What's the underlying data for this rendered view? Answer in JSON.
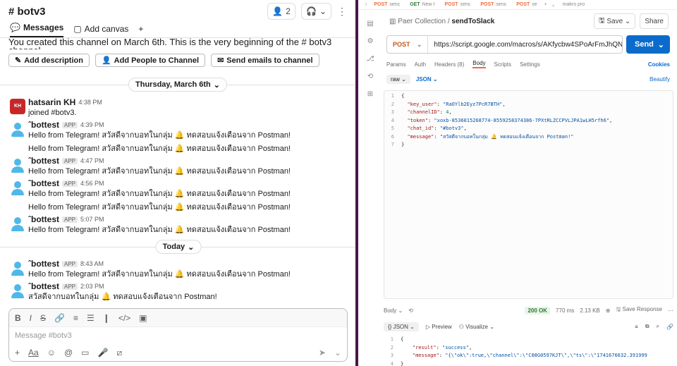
{
  "slack": {
    "channel": "# botv3",
    "members_count": "2",
    "tabs": [
      {
        "label": "Messages"
      },
      {
        "label": "Add canvas"
      }
    ],
    "intro": "You created this channel on March 6th. This is the very beginning of the # botv3 channel.",
    "buttons": {
      "add_description": "Add description",
      "add_people": "Add People to Channel",
      "send_emails": "Send emails to channel"
    },
    "date1": "Thursday, March 6th",
    "date2": "Today",
    "messages": [
      {
        "name": "hatsarin KH",
        "time": "4:38 PM",
        "lines": [
          "joined #botv3."
        ],
        "app": ""
      },
      {
        "name": "ˆbottest",
        "app": "APP",
        "time": "4:39 PM",
        "lines": [
          "Hello from Telegram! สวัสดีจากบอทในกลุ่ม 🔔 ทดสอบแจ้งเตือนจาก Postman!",
          "Hello from Telegram! สวัสดีจากบอทในกลุ่ม 🔔 ทดสอบแจ้งเตือนจาก Postman!"
        ]
      },
      {
        "name": "ˆbottest",
        "app": "APP",
        "time": "4:47 PM",
        "lines": [
          "Hello from Telegram! สวัสดีจากบอทในกลุ่ม 🔔 ทดสอบแจ้งเตือนจาก Postman!"
        ]
      },
      {
        "name": "ˆbottest",
        "app": "APP",
        "time": "4:56 PM",
        "lines": [
          "Hello from Telegram! สวัสดีจากบอทในกลุ่ม 🔔 ทดสอบแจ้งเตือนจาก Postman!",
          "Hello from Telegram! สวัสดีจากบอทในกลุ่ม 🔔 ทดสอบแจ้งเตือนจาก Postman!"
        ]
      },
      {
        "name": "ˆbottest",
        "app": "APP",
        "time": "5:07 PM",
        "lines": [
          "Hello from Telegram! สวัสดีจากบอทในกลุ่ม 🔔 ทดสอบแจ้งเตือนจาก Postman!"
        ]
      },
      {
        "name": "ˆbottest",
        "app": "APP",
        "time": "8:43 AM",
        "lines": [
          "Hello from Telegram! สวัสดีจากบอทในกลุ่ม 🔔 ทดสอบแจ้งเตือนจาก Postman!"
        ]
      },
      {
        "name": "ˆbottest",
        "app": "APP",
        "time": "2:03 PM",
        "lines": [
          "สวัสดีจากบอทในกลุ่ม 🔔 ทดสอบแจ้งเตือนจาก Postman!"
        ]
      }
    ],
    "composer_placeholder": "Message #botv3"
  },
  "postman": {
    "tabs": [
      {
        "method": "POST",
        "name": "senc"
      },
      {
        "method": "GET",
        "name": "New I"
      },
      {
        "method": "POST",
        "name": "senc"
      },
      {
        "method": "POST",
        "name": "senc"
      },
      {
        "method": "POST",
        "name": "se"
      },
      {
        "method": "",
        "name": "makro pro"
      }
    ],
    "collection": "Paer Collection",
    "request_name": "sendToSlack",
    "save_label": "Save",
    "share_label": "Share",
    "method": "POST",
    "url": "https://script.google.com/macros/s/AKfycbw4SPoArFmJhQNwlhxpD_",
    "send_label": "Send",
    "req_tabs": [
      "Params",
      "Auth",
      "Headers (8)",
      "Body",
      "Scripts",
      "Settings"
    ],
    "cookies_label": "Cookies",
    "body_mode": "raw",
    "body_type": "JSON",
    "beautify_label": "Beautify",
    "body_lines": [
      {
        "n": "1",
        "text": "{"
      },
      {
        "n": "2",
        "key": "\"key_user\"",
        "val": "\"RaOYlb2Eyz7PcR7BTH\"",
        "comma": ","
      },
      {
        "n": "3",
        "key": "\"channelID\"",
        "val": "4",
        "comma": ","
      },
      {
        "n": "4",
        "key": "\"token\"",
        "val": "\"xoxb-8536015268774-8559258374386-7PXtRLZCCPVLJPA1wLH5rfh6\"",
        "comma": ","
      },
      {
        "n": "5",
        "key": "\"chat_id\"",
        "val": "\"#botv3\"",
        "comma": ","
      },
      {
        "n": "6",
        "key": "\"message\"",
        "val": "\"สวัสดีจากบอทในกลุ่ม 🔔 ทดสอบแจ้งเตือนจาก Postman!\"",
        "comma": ""
      },
      {
        "n": "7",
        "text": "}"
      }
    ],
    "res_label": "Body",
    "status": "200 OK",
    "time": "770 ms",
    "size": "2.13 KB",
    "save_response": "Save Response",
    "res_type": "JSON",
    "preview": "Preview",
    "visualize": "Visualize",
    "res_lines": [
      {
        "n": "1",
        "text": "{"
      },
      {
        "n": "2",
        "key": "\"result\"",
        "val": "\"success\"",
        "comma": ","
      },
      {
        "n": "3",
        "key": "\"message\"",
        "val": "\"{\\\"ok\\\":true,\\\"channel\\\":\\\"C08G0597KJT\\\",\\\"ts\\\":\\\"1741676632.391999",
        "comma": ""
      },
      {
        "n": "4",
        "text": "}"
      }
    ]
  },
  "colors": {
    "accent": "#0b6bcb",
    "slack_aubergine": "#4a154b",
    "postman_orange": "#f26b3a"
  }
}
